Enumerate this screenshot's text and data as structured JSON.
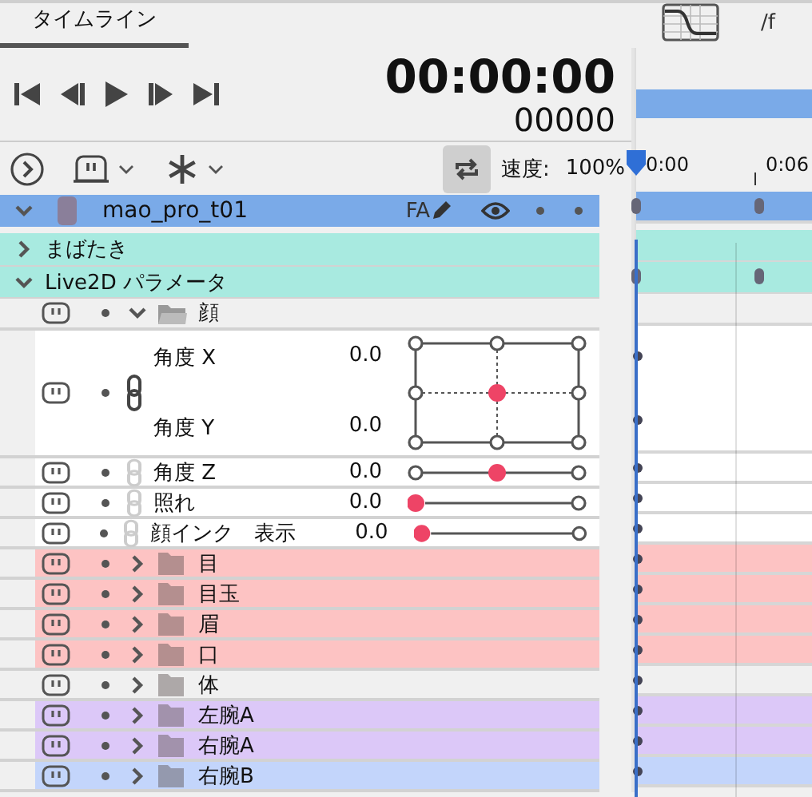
{
  "tab": {
    "label": "タイムライン",
    "selected": true
  },
  "playback": {
    "timecode": "00:00:00",
    "frame": "00000"
  },
  "toolbar": {
    "loop_on": true,
    "speed_label": "速度:",
    "speed_value": "100%"
  },
  "timeline": {
    "rate_label": "/f",
    "ruler": [
      "0:00",
      "0:06"
    ]
  },
  "model": {
    "name": "mao_pro_t01",
    "expanded": true,
    "flag": "FA"
  },
  "rows": [
    {
      "kind": "group",
      "label": "まばたき",
      "expanded": false,
      "color": "#a8eae0"
    },
    {
      "kind": "group",
      "label": "Live2D パラメータ",
      "expanded": true,
      "color": "#a8eae0"
    },
    {
      "kind": "folder",
      "label": "顔",
      "expanded": true,
      "color": "#f0f0f0"
    },
    {
      "kind": "pad",
      "linked": true,
      "params": [
        {
          "label": "角度 X",
          "value": "0.0",
          "level": 0.5
        },
        {
          "label": "角度 Y",
          "value": "0.0",
          "level": 0.5
        }
      ]
    },
    {
      "kind": "slider",
      "linked": false,
      "label": "角度 Z",
      "value": "0.0",
      "level": 0.5
    },
    {
      "kind": "slider",
      "linked": false,
      "label": "照れ",
      "value": "0.0",
      "level": 0
    },
    {
      "kind": "slider",
      "linked": false,
      "label": "顔インク　表示",
      "value": "0.0",
      "level": 0
    },
    {
      "kind": "folder",
      "label": "目",
      "expanded": false,
      "color": "#fdc3c3"
    },
    {
      "kind": "folder",
      "label": "目玉",
      "expanded": false,
      "color": "#fdc3c3"
    },
    {
      "kind": "folder",
      "label": "眉",
      "expanded": false,
      "color": "#fdc3c3"
    },
    {
      "kind": "folder",
      "label": "口",
      "expanded": false,
      "color": "#fdc3c3"
    },
    {
      "kind": "folder",
      "label": "体",
      "expanded": false,
      "color": "#f0f0f0"
    },
    {
      "kind": "folder",
      "label": "左腕A",
      "expanded": false,
      "color": "#dcc8f8"
    },
    {
      "kind": "folder",
      "label": "右腕A",
      "expanded": false,
      "color": "#dcc8f8"
    },
    {
      "kind": "folder",
      "label": "右腕B",
      "expanded": false,
      "color": "#c3d5fb"
    }
  ]
}
